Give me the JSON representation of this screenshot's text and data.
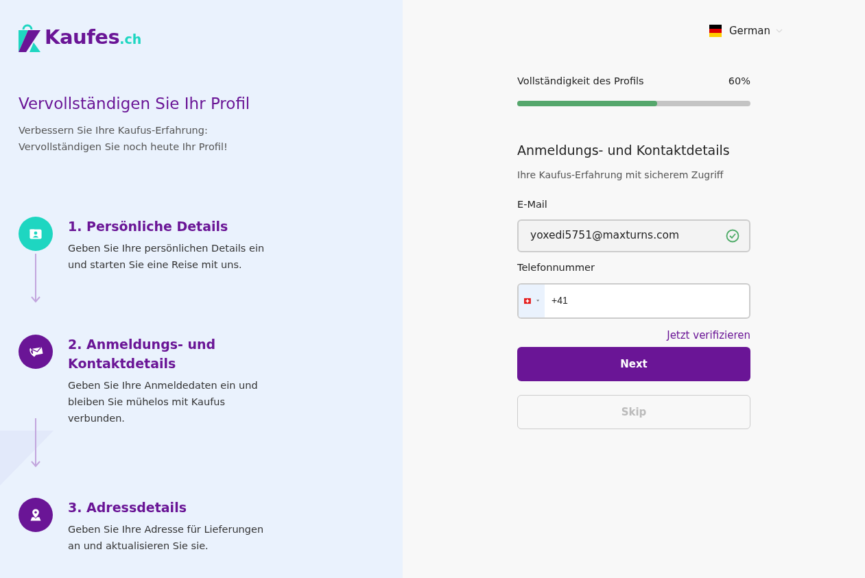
{
  "logo": {
    "name": "Kaufes",
    "suffix": ".ch"
  },
  "intro": {
    "title": "Vervollständigen Sie Ihr Profil",
    "text": "Verbessern Sie Ihre Kaufus-Erfahrung: Vervollständigen Sie noch heute Ihr Profil!"
  },
  "steps": [
    {
      "kind": "contact",
      "completed": true,
      "title": "1. Persönliche Details",
      "text": "Geben Sie Ihre persönlichen Details ein und starten Sie eine Reise mit uns."
    },
    {
      "kind": "phone-mail",
      "completed": false,
      "title": "2. Anmeldungs- und Kontaktdetails",
      "text": "Geben Sie Ihre Anmeldedaten ein und bleiben Sie mühelos mit Kaufus verbunden."
    },
    {
      "kind": "location",
      "completed": false,
      "title": "3. Adressdetails",
      "text": "Geben Sie Ihre Adresse für Lieferungen an und aktualisieren Sie sie."
    }
  ],
  "language": {
    "label": "German"
  },
  "progress": {
    "label": "Vollständigkeit des Profils",
    "reading": "60%",
    "level": 0.6
  },
  "form": {
    "title": "Anmeldungs- und Kontaktdetails",
    "subtitle": "Ihre Kaufus-Erfahrung mit sicherem Zugriff",
    "email": {
      "label": "E-Mail",
      "value": "yoxedi5751@maxturns.com",
      "verified": true
    },
    "phone": {
      "label": "Telefonnummer",
      "value": "+41"
    },
    "verify_link": "Jetzt verifizieren",
    "buttons": [
      {
        "kind": "primary",
        "label": "Next",
        "disabled": false
      },
      {
        "kind": "secondary",
        "label": "Skip",
        "disabled": true
      }
    ]
  }
}
